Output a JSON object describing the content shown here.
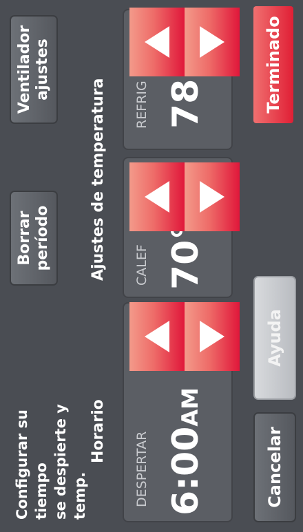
{
  "header": {
    "instruction_line1": "Configurar su tiempo",
    "instruction_line2": "se despierte y temp."
  },
  "buttons": {
    "delete_line1": "Borrar",
    "delete_line2": "período",
    "fan_line1": "Ventilador",
    "fan_line2": "ajustes",
    "cancel": "Cancelar",
    "help": "Ayuda",
    "done": "Terminado"
  },
  "schedule": {
    "heading": "Horario",
    "period_label": "DESPERTAR",
    "time": "6:00",
    "ampm": "AM"
  },
  "temperature": {
    "heading": "Ajustes de temperatura",
    "heat_label": "CALEF",
    "heat_value": "70°",
    "cool_label": "REFRIG",
    "cool_value": "78°"
  }
}
